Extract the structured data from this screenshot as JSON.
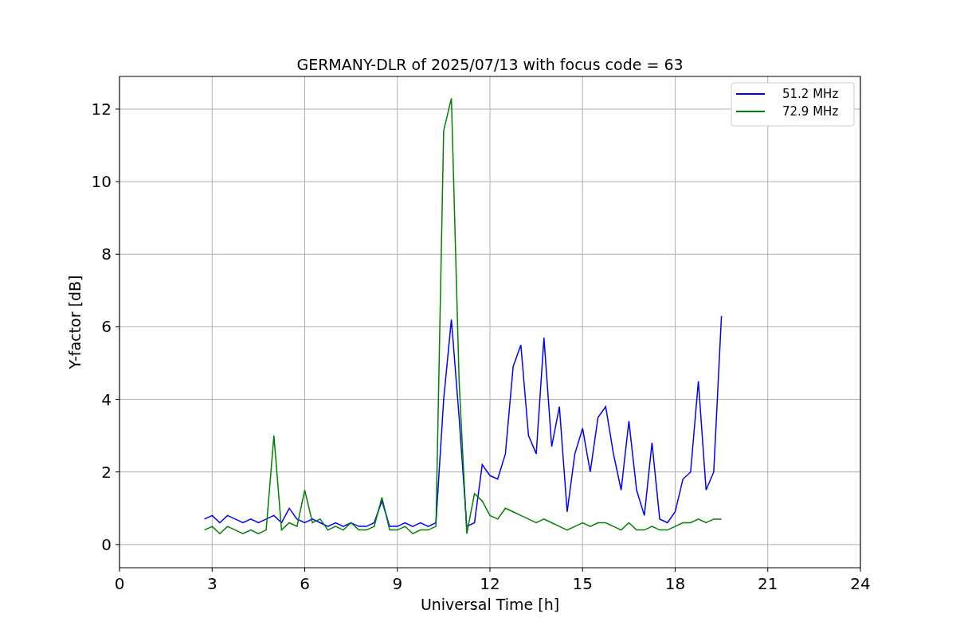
{
  "figure": {
    "chart_data": {
      "type": "line",
      "title": "GERMANY-DLR of 2025/07/13 with focus code = 63",
      "xlabel": "Universal Time [h]",
      "ylabel": "Y-factor [dB]",
      "x": [
        2.75,
        3,
        3.25,
        3.5,
        3.75,
        4,
        4.25,
        4.5,
        4.75,
        5,
        5.25,
        5.5,
        5.75,
        6,
        6.25,
        6.5,
        6.75,
        7,
        7.25,
        7.5,
        7.75,
        8,
        8.25,
        8.5,
        8.75,
        9,
        9.25,
        9.5,
        9.75,
        10,
        10.25,
        10.5,
        10.75,
        11,
        11.25,
        11.5,
        11.75,
        12,
        12.25,
        12.5,
        12.75,
        13,
        13.25,
        13.5,
        13.75,
        14,
        14.25,
        14.5,
        14.75,
        15,
        15.25,
        15.5,
        15.75,
        16,
        16.25,
        16.5,
        16.75,
        17,
        17.25,
        17.5,
        17.75,
        18,
        18.25,
        18.5,
        18.75,
        19,
        19.25,
        19.5
      ],
      "series": [
        {
          "name": "51.2 MHz",
          "color": "#0000ff",
          "values": [
            0.7,
            0.8,
            0.6,
            0.8,
            0.7,
            0.6,
            0.7,
            0.6,
            0.7,
            0.8,
            0.6,
            1.0,
            0.7,
            0.6,
            0.7,
            0.6,
            0.5,
            0.6,
            0.5,
            0.6,
            0.5,
            0.5,
            0.6,
            1.2,
            0.5,
            0.5,
            0.6,
            0.5,
            0.6,
            0.5,
            0.6,
            4.0,
            6.2,
            3.5,
            0.5,
            0.6,
            2.2,
            1.9,
            1.8,
            2.5,
            4.9,
            5.5,
            3.0,
            2.5,
            5.7,
            2.7,
            3.8,
            0.9,
            2.5,
            3.2,
            2.0,
            3.5,
            3.8,
            2.5,
            1.5,
            3.4,
            1.5,
            0.8,
            2.8,
            0.7,
            0.6,
            0.9,
            1.8,
            2.0,
            4.5,
            1.5,
            2.0,
            6.3
          ]
        },
        {
          "name": "72.9 MHz",
          "color": "#008000",
          "values": [
            0.4,
            0.5,
            0.3,
            0.5,
            0.4,
            0.3,
            0.4,
            0.3,
            0.4,
            3.0,
            0.4,
            0.6,
            0.5,
            1.5,
            0.6,
            0.7,
            0.4,
            0.5,
            0.4,
            0.6,
            0.4,
            0.4,
            0.5,
            1.3,
            0.4,
            0.4,
            0.5,
            0.3,
            0.4,
            0.4,
            0.5,
            11.4,
            12.3,
            4.5,
            0.3,
            1.4,
            1.2,
            0.8,
            0.7,
            1.0,
            0.9,
            0.8,
            0.7,
            0.6,
            0.7,
            0.6,
            0.5,
            0.4,
            0.5,
            0.6,
            0.5,
            0.6,
            0.6,
            0.5,
            0.4,
            0.6,
            0.4,
            0.4,
            0.5,
            0.4,
            0.4,
            0.5,
            0.6,
            0.6,
            0.7,
            0.6,
            0.7,
            0.7
          ]
        }
      ],
      "grid": true,
      "legend": "upper right",
      "xlim": [
        0,
        24
      ],
      "ylim": [
        -0.64,
        12.9
      ],
      "xticks": [
        0,
        3,
        6,
        9,
        12,
        15,
        18,
        21,
        24
      ],
      "yticks": [
        0,
        2,
        4,
        6,
        8,
        10,
        12
      ]
    }
  }
}
